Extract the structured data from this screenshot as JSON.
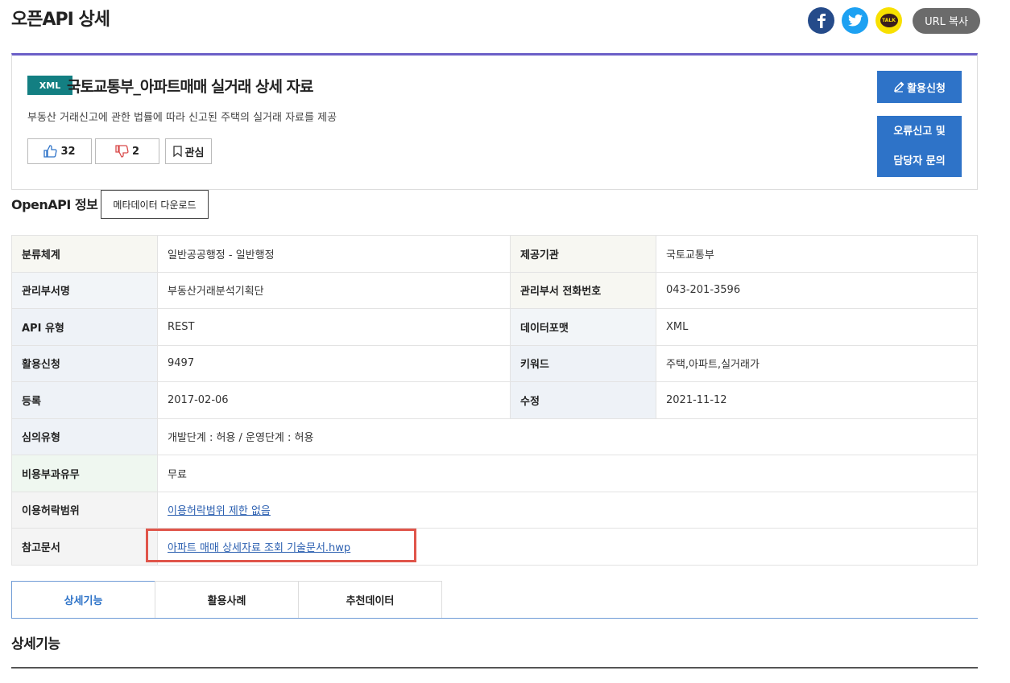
{
  "page": {
    "title": "오픈API 상세"
  },
  "share": {
    "kakao_label": "TALK",
    "url_copy": "URL 복사"
  },
  "api": {
    "format_badge": "XML",
    "title": "국토교통부_아파트매매 실거래 상세 자료",
    "description": "부동산 거래신고에 관한 법률에 따라 신고된 주택의 실거래 자료를 제공",
    "likes": "32",
    "dislikes": "2",
    "interest_label": "관심"
  },
  "actions": {
    "apply": "활용신청",
    "report_line1": "오류신고 및",
    "report_line2": "담당자 문의"
  },
  "section": {
    "title": "OpenAPI 정보",
    "metadata_download": "메타데이터 다운로드"
  },
  "info": {
    "category_label": "분류체계",
    "category": "일반공공행정 - 일반행정",
    "provider_label": "제공기관",
    "provider": "국토교통부",
    "dept_label": "관리부서명",
    "dept": "부동산거래분석기획단",
    "phone_label": "관리부서 전화번호",
    "phone": "043-201-3596",
    "api_type_label": "API 유형",
    "api_type": "REST",
    "data_format_label": "데이터포맷",
    "data_format": "XML",
    "applications_label": "활용신청",
    "applications": "9497",
    "keywords_label": "키워드",
    "keywords": "주택,아파트,실거래가",
    "registered_label": "등록",
    "registered": "2017-02-06",
    "modified_label": "수정",
    "modified": "2021-11-12",
    "review_label": "심의유형",
    "review": "개발단계 : 허용 / 운영단계 : 허용",
    "cost_label": "비용부과유무",
    "cost": "무료",
    "license_label": "이용허락범위",
    "license": "이용허락범위 제한 없음",
    "reference_label": "참고문서",
    "reference": "아파트 매매 상세자료 조회 기술문서.hwp"
  },
  "tabs": [
    "상세기능",
    "활용사례",
    "추천데이터"
  ],
  "detail": {
    "title": "상세기능"
  },
  "colors": {
    "accent": "#2e73c8",
    "badge": "#137f82",
    "card_top": "#6b5fc7",
    "highlight": "#e0554a"
  }
}
